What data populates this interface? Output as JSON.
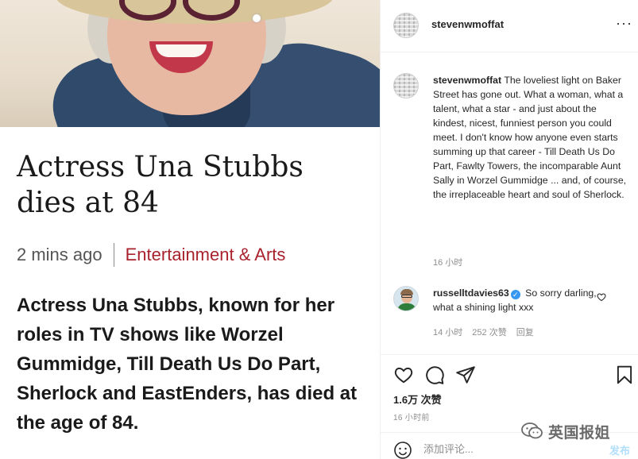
{
  "article": {
    "headline": "Actress Una Stubbs dies at 84",
    "time": "2 mins ago",
    "category": "Entertainment & Arts",
    "summary": "Actress Una Stubbs, known for her roles in TV shows like Worzel Gummidge, Till Death Us Do Part, Sherlock and EastEnders, has died at the age of 84."
  },
  "post": {
    "username": "stevenwmoffat",
    "more_label": "···",
    "caption_user": "stevenwmoffat",
    "caption_text": "The loveliest light on Baker Street has gone out. What a woman, what a talent, what a star - and just about the kindest, nicest, funniest person you could meet. I don't know how anyone even starts summing up that career - Till Death Us Do Part, Fawlty Towers, the incomparable Aunt Sally in Worzel Gummidge ... and, of course, the irreplaceable heart and soul of Sherlock.",
    "caption_time": "16 小时"
  },
  "comment": {
    "username": "russelltdavies63",
    "verified_mark": "✓",
    "text": "So sorry darling, what a shining light xxx",
    "time": "14 小时",
    "likes": "252 次赞",
    "reply": "回复"
  },
  "engagement": {
    "likes": "1.6万 次赞",
    "time": "16 小时前"
  },
  "add_comment": {
    "placeholder": "添加评论...",
    "post_label": "发布"
  },
  "watermark": {
    "text": "英国报姐"
  },
  "colors": {
    "bbc_red": "#a8222d",
    "verified_blue": "#3897f0",
    "post_button_disabled": "#b2dffc",
    "muted_text": "#8e8e8e"
  },
  "icons": [
    "more-icon",
    "heart-icon",
    "comment-icon",
    "share-icon",
    "bookmark-icon",
    "emoji-icon",
    "verified-icon",
    "wechat-icon"
  ]
}
